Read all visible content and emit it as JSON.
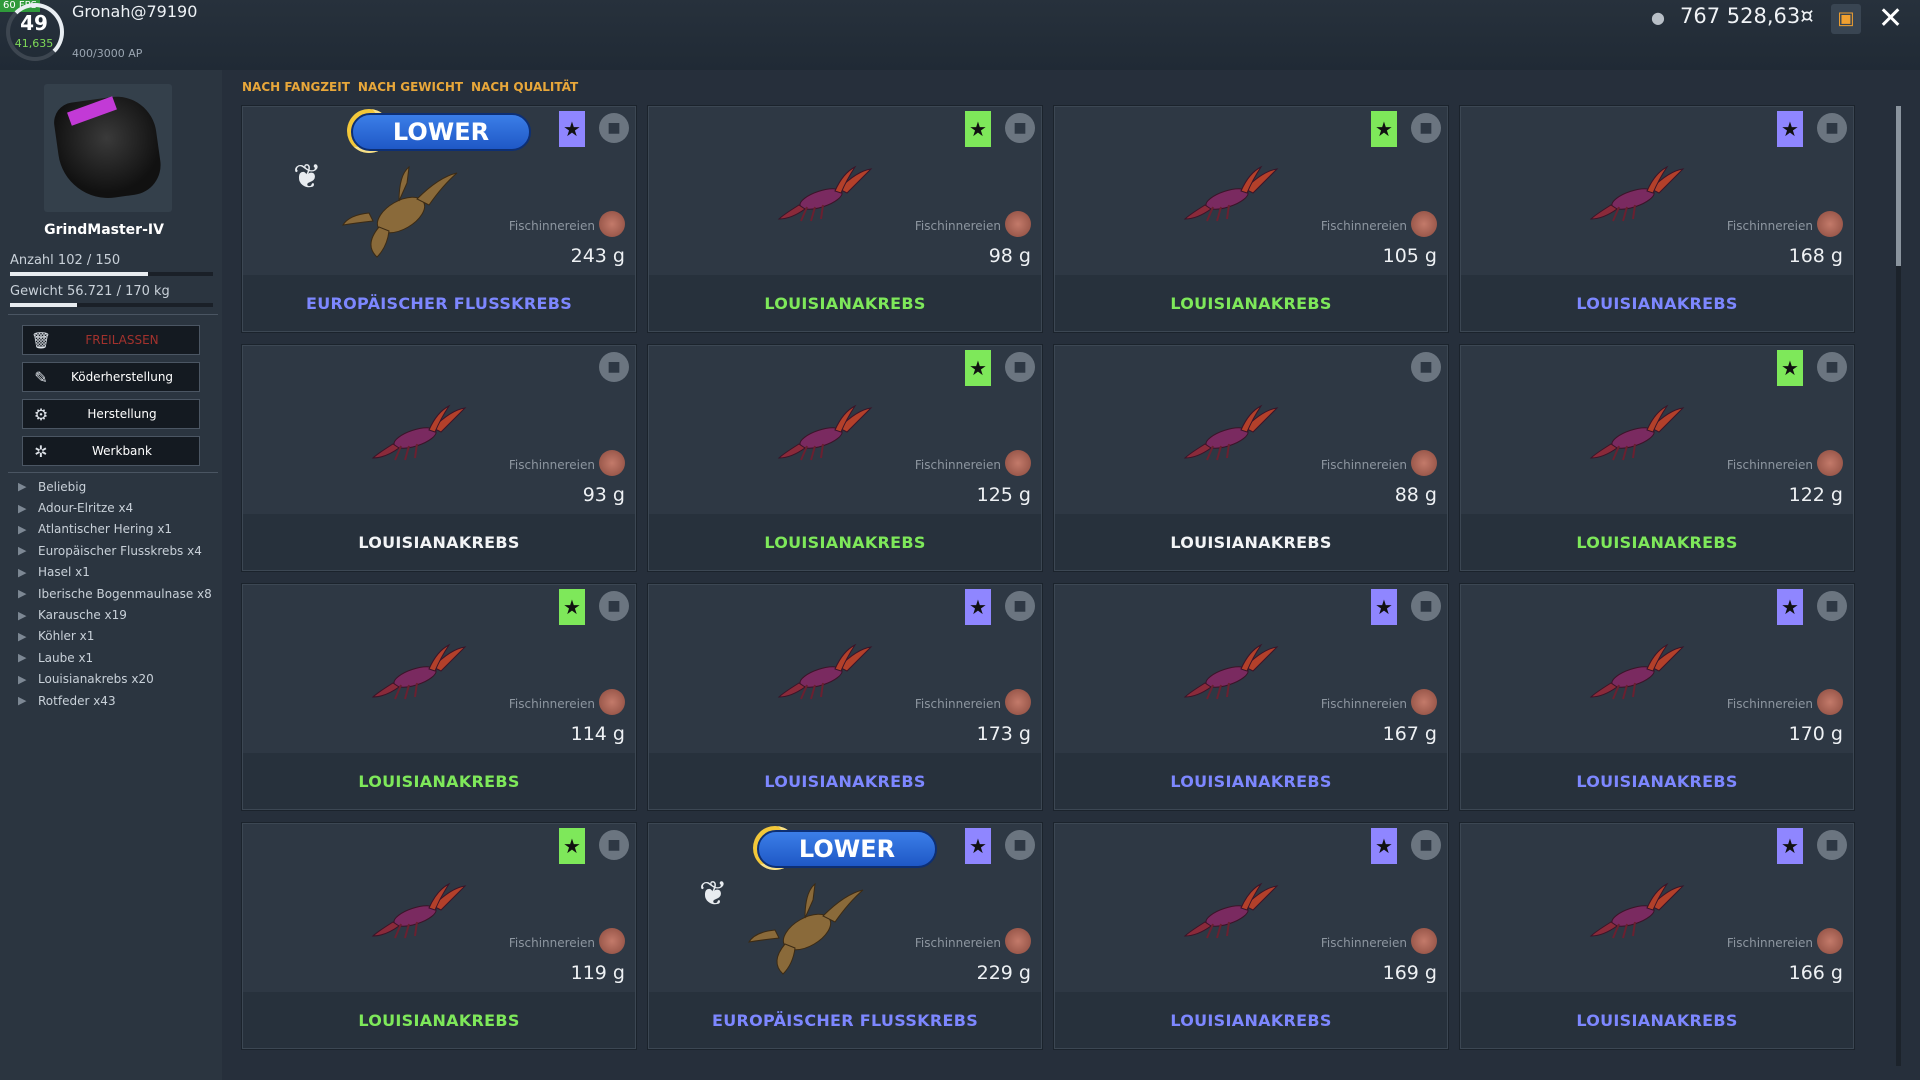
{
  "header": {
    "fps": "60 FPS",
    "level": "49",
    "xp": "41,635",
    "username": "Gronah@79190",
    "ap": "400/3000 AP",
    "money": "767 528,63¤",
    "money_icon": "coin-icon",
    "close_label": "✕"
  },
  "sidebar": {
    "net_name": "GrindMaster-IV",
    "count_label": "Anzahl",
    "count_value": "102 / 150",
    "count_fraction": 0.68,
    "weight_label": "Gewicht",
    "weight_value": "56.721 / 170 kg",
    "weight_fraction": 0.33,
    "buttons": [
      {
        "label": "FREILASSEN",
        "icon": "trash-icon",
        "disabled": true
      },
      {
        "label": "Köderherstellung",
        "icon": "bait-craft-icon"
      },
      {
        "label": "Herstellung",
        "icon": "gear-icon"
      },
      {
        "label": "Werkbank",
        "icon": "workbench-icon"
      }
    ],
    "filters": [
      "Beliebig",
      "Adour-Elritze x4",
      "Atlantischer Hering x1",
      "Europäischer Flusskrebs x4",
      "Hasel x1",
      "Iberische Bogenmaulnase x8",
      "Karausche x19",
      "Köhler x1",
      "Laube x1",
      "Louisianakrebs x20",
      "Rotfeder x43"
    ]
  },
  "sort": [
    "NACH FANGZEIT",
    "NACH GEWICHT",
    "NACH QUALITÄT"
  ],
  "bait_label": "Fischinnereien",
  "lower_label": "LOWER",
  "colors": {
    "green": "#7ee85a",
    "blue": "#7d87ff",
    "accent": "#e8a73a"
  },
  "catches": [
    {
      "name": "EUROPÄISCHER FLUSSKREBS",
      "weight": "243 g",
      "quality": "blue",
      "star": "blue",
      "lower": true
    },
    {
      "name": "LOUISIANAKREBS",
      "weight": "98 g",
      "quality": "green",
      "star": "green",
      "lower": false
    },
    {
      "name": "LOUISIANAKREBS",
      "weight": "105 g",
      "quality": "green",
      "star": "green",
      "lower": false
    },
    {
      "name": "LOUISIANAKREBS",
      "weight": "168 g",
      "quality": "blue",
      "star": "blue",
      "lower": false
    },
    {
      "name": "LOUISIANAKREBS",
      "weight": "93 g",
      "quality": "white",
      "star": "",
      "lower": false
    },
    {
      "name": "LOUISIANAKREBS",
      "weight": "125 g",
      "quality": "green",
      "star": "green",
      "lower": false
    },
    {
      "name": "LOUISIANAKREBS",
      "weight": "88 g",
      "quality": "white",
      "star": "",
      "lower": false
    },
    {
      "name": "LOUISIANAKREBS",
      "weight": "122 g",
      "quality": "green",
      "star": "green",
      "lower": false
    },
    {
      "name": "LOUISIANAKREBS",
      "weight": "114 g",
      "quality": "green",
      "star": "green",
      "lower": false
    },
    {
      "name": "LOUISIANAKREBS",
      "weight": "173 g",
      "quality": "blue",
      "star": "blue",
      "lower": false
    },
    {
      "name": "LOUISIANAKREBS",
      "weight": "167 g",
      "quality": "blue",
      "star": "blue",
      "lower": false
    },
    {
      "name": "LOUISIANAKREBS",
      "weight": "170 g",
      "quality": "blue",
      "star": "blue",
      "lower": false
    },
    {
      "name": "LOUISIANAKREBS",
      "weight": "119 g",
      "quality": "green",
      "star": "green",
      "lower": false
    },
    {
      "name": "EUROPÄISCHER FLUSSKREBS",
      "weight": "229 g",
      "quality": "blue",
      "star": "blue",
      "lower": true
    },
    {
      "name": "LOUISIANAKREBS",
      "weight": "169 g",
      "quality": "blue",
      "star": "blue",
      "lower": false
    },
    {
      "name": "LOUISIANAKREBS",
      "weight": "166 g",
      "quality": "blue",
      "star": "blue",
      "lower": false
    }
  ]
}
